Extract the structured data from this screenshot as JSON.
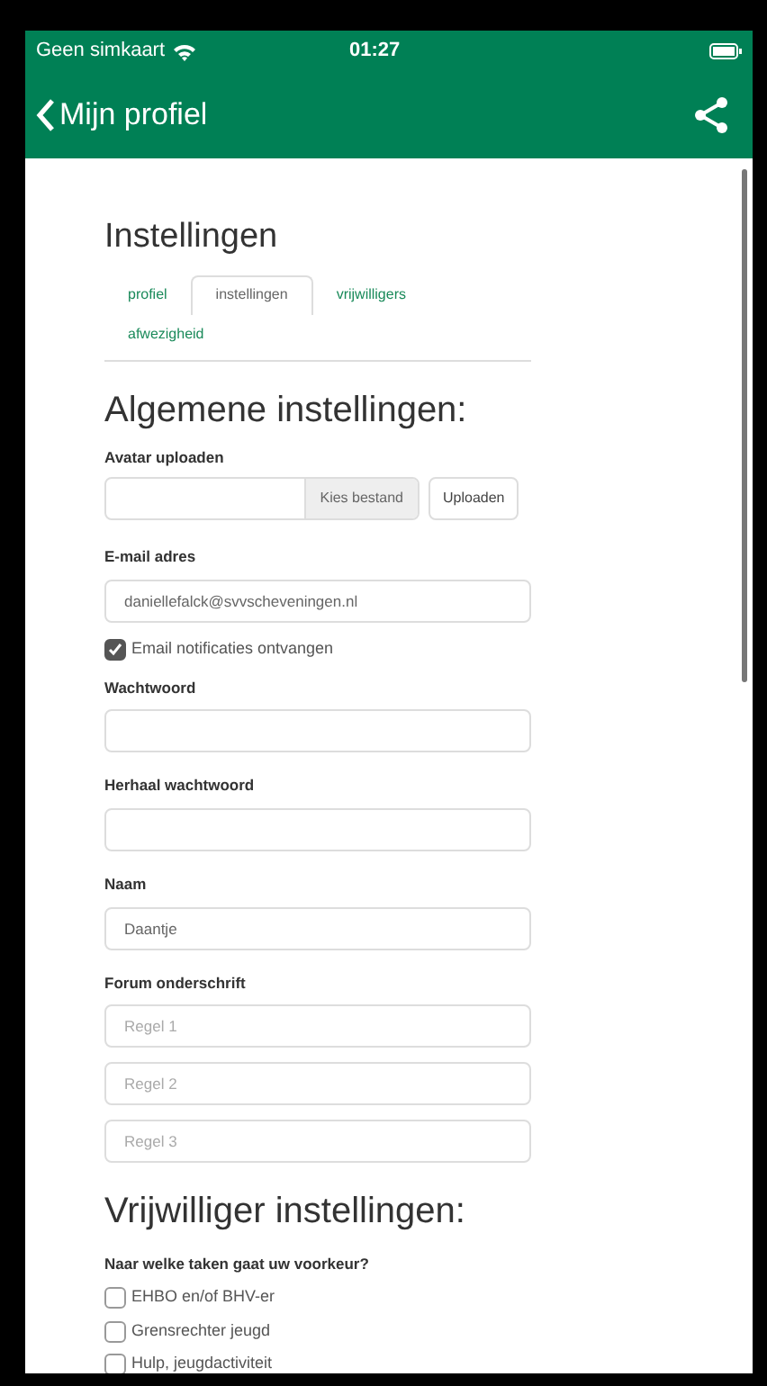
{
  "status_bar": {
    "carrier": "Geen simkaart",
    "time": "01:27"
  },
  "nav": {
    "back_label": "Mijn profiel"
  },
  "page_title": "Instellingen",
  "tabs": [
    {
      "label": "profiel",
      "selected": false
    },
    {
      "label": "instellingen",
      "selected": true
    },
    {
      "label": "vrijwilligers",
      "selected": false
    },
    {
      "label": "afwezigheid",
      "selected": false
    }
  ],
  "general": {
    "heading": "Algemene instellingen:",
    "avatar": {
      "label": "Avatar uploaden",
      "choose_button": "Kies bestand",
      "upload_button": "Uploaden"
    },
    "fields": [
      {
        "kind": "text",
        "label": "E-mail adres",
        "value": "daniellefalck@svvscheveningen.nl"
      },
      {
        "kind": "checkbox",
        "label": "Email notificaties ontvangen",
        "checked": true
      },
      {
        "kind": "text",
        "label": "Wachtwoord"
      },
      {
        "kind": "text",
        "label": "Herhaal wachtwoord"
      },
      {
        "kind": "text",
        "label": "Naam",
        "value": "Daantje"
      }
    ],
    "signature": {
      "label": "Forum onderschrift",
      "lines": [
        {
          "placeholder": "Regel 1"
        },
        {
          "placeholder": "Regel 2"
        },
        {
          "placeholder": "Regel 3"
        }
      ]
    }
  },
  "volunteer": {
    "heading": "Vrijwilliger instellingen:",
    "question": "Naar welke taken gaat uw voorkeur?",
    "options": [
      {
        "label": "EHBO en/of BHV-er",
        "checked": false
      },
      {
        "label": "Grensrechter jeugd",
        "checked": false
      },
      {
        "label": "Hulp, jeugdactiviteit",
        "checked": false
      }
    ]
  }
}
